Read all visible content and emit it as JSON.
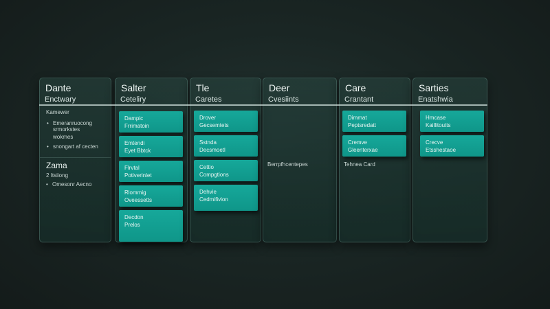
{
  "columns": [
    {
      "title": "Dante",
      "subtitle": "Enctwary",
      "label": "Kamewer",
      "bullets": [
        "Emeranruocong",
        "srmorkstes"
      ],
      "indent_text": "wokmes",
      "extra": "snongart af cecten",
      "section2": {
        "title": "Zama",
        "items": [
          "2 Itsiiong",
          "Omesonr Aecno"
        ]
      }
    },
    {
      "title": "Salter",
      "subtitle": "Ceteliry",
      "cards": [
        {
          "line1": "Dampic",
          "line2": "Frrimatoin"
        },
        {
          "line1": "Emtendi",
          "line2": "Eyet Bbtck"
        },
        {
          "line1": "Flrvtal",
          "line2": "Potiverinlet"
        },
        {
          "line1": "Rlommig",
          "line2": "Oveessetts"
        },
        {
          "line1": "Decdon",
          "line2": "Prelos"
        }
      ]
    },
    {
      "title": "Tle",
      "subtitle": "Caretes",
      "cards": [
        {
          "line1": "Drover",
          "line2": "Gecsemtets"
        },
        {
          "line1": "Sstnda",
          "line2": "Decsmoetl"
        },
        {
          "line1": "Cettio",
          "line2": "Compgtions"
        },
        {
          "line1": "Dehvie",
          "line2": "Cedmifivion"
        }
      ]
    },
    {
      "title": "Deer",
      "subtitle": "Cvesiints",
      "note": "Berrpfhcentepes"
    },
    {
      "title": "Care",
      "subtitle": "Crantant",
      "cards": [
        {
          "line1": "Dimmat",
          "line2": "Peptsredatt"
        },
        {
          "line1": "Cremve",
          "line2": "Gleenterxae"
        }
      ],
      "note": "Tehnea Card"
    },
    {
      "title": "Sarties",
      "subtitle": "Enatshwia",
      "cards": [
        {
          "line1": "Hmcase",
          "line2": "Kaillitoutts"
        },
        {
          "line1": "Crecve",
          "line2": "Etsshestaoe"
        }
      ]
    }
  ]
}
